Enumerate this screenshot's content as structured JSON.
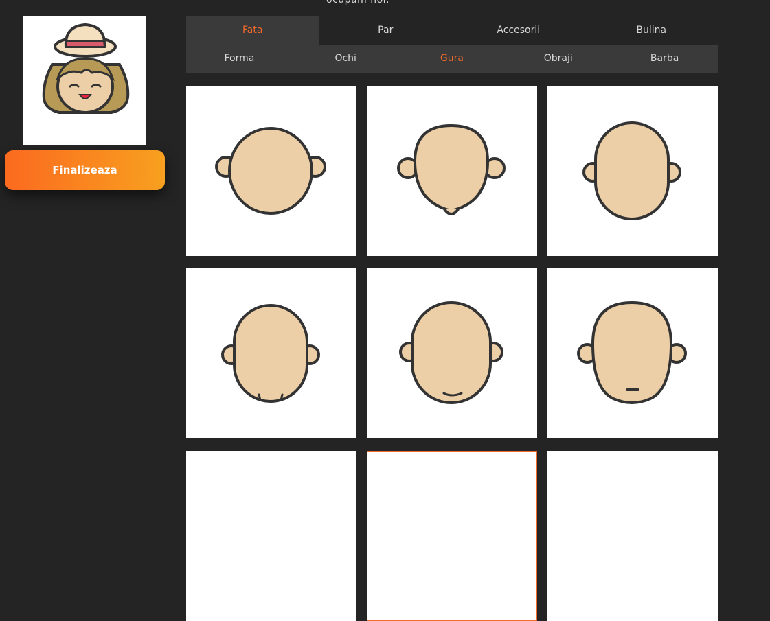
{
  "top_text": "ocupam noi.",
  "finalize_label": "Finalizeaza",
  "preview": {
    "icon": "avatar-girl-hat-icon"
  },
  "tabs_primary": [
    {
      "label": "Fata",
      "active": true
    },
    {
      "label": "Par",
      "active": false
    },
    {
      "label": "Accesorii",
      "active": false
    },
    {
      "label": "Bulina",
      "active": false
    }
  ],
  "tabs_secondary": [
    {
      "label": "Forma",
      "active": false
    },
    {
      "label": "Ochi",
      "active": false
    },
    {
      "label": "Gura",
      "active": true
    },
    {
      "label": "Obraji",
      "active": false
    },
    {
      "label": "Barba",
      "active": false
    }
  ],
  "options": [
    {
      "icon": "face-round-icon"
    },
    {
      "icon": "face-chin-icon"
    },
    {
      "icon": "face-oval-icon"
    },
    {
      "icon": "face-cleft-chin-icon"
    },
    {
      "icon": "face-smile-line-icon"
    },
    {
      "icon": "face-dash-chin-icon"
    }
  ],
  "colors": {
    "accent": "#f26a2c",
    "background": "#242424",
    "tab_bar": "#3a3a3a",
    "skin": "#edcfa7",
    "outline": "#333333"
  }
}
